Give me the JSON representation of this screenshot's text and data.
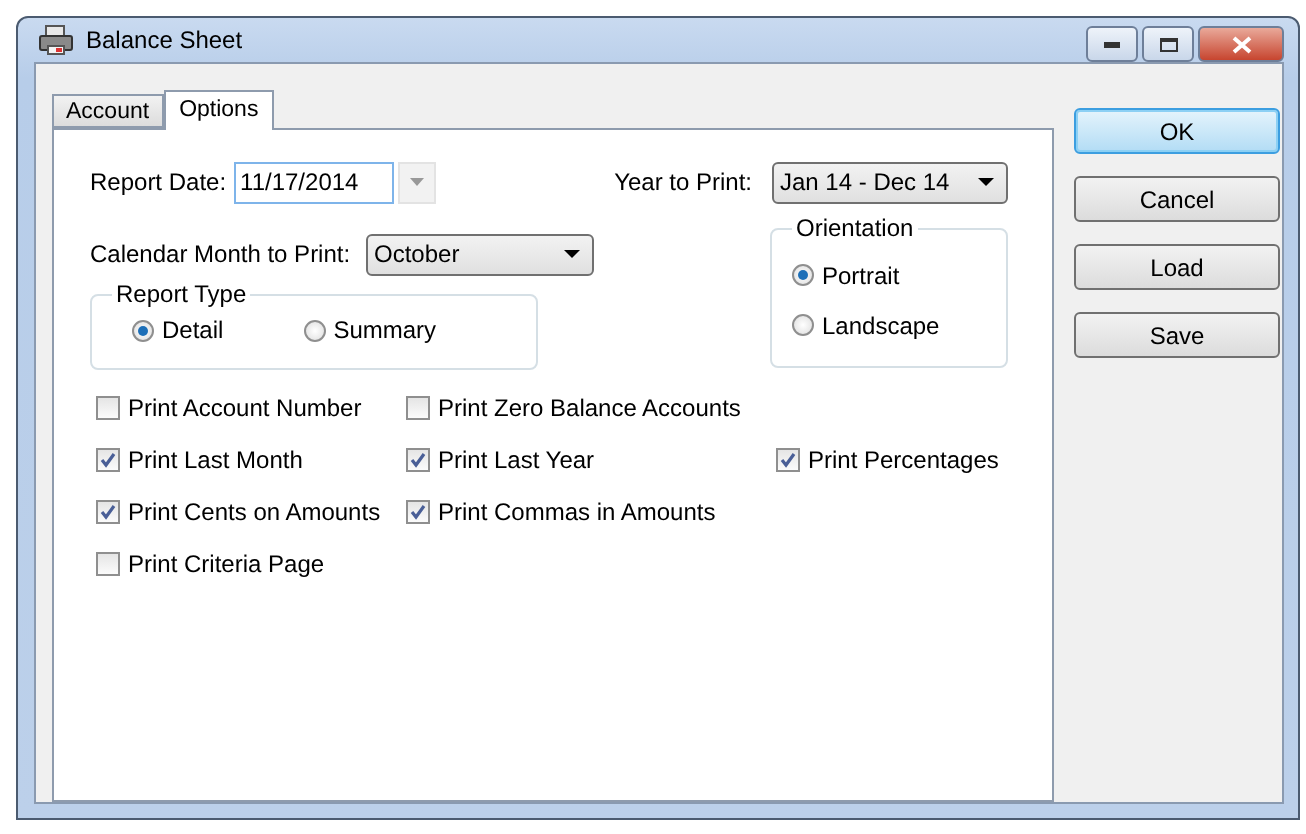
{
  "window": {
    "title": "Balance Sheet"
  },
  "tabs": [
    {
      "label": "Account",
      "selected": false
    },
    {
      "label": "Options",
      "selected": true
    }
  ],
  "report_date": {
    "label": "Report Date:",
    "value": "11/17/2014"
  },
  "year_to_print": {
    "label": "Year to Print:",
    "value": "Jan 14 - Dec 14"
  },
  "calendar_month": {
    "label": "Calendar Month to Print:",
    "value": "October"
  },
  "report_type": {
    "title": "Report Type",
    "options": [
      {
        "label": "Detail",
        "selected": true
      },
      {
        "label": "Summary",
        "selected": false
      }
    ]
  },
  "orientation": {
    "title": "Orientation",
    "options": [
      {
        "label": "Portrait",
        "selected": true
      },
      {
        "label": "Landscape",
        "selected": false
      }
    ]
  },
  "checkbox_rows": [
    [
      {
        "label": "Print Account Number",
        "checked": false
      },
      {
        "label": "Print Zero Balance Accounts",
        "checked": false
      }
    ],
    [
      {
        "label": "Print Last Month",
        "checked": true
      },
      {
        "label": "Print Last Year",
        "checked": true
      },
      {
        "label": "Print Percentages",
        "checked": true
      }
    ],
    [
      {
        "label": "Print Cents on Amounts",
        "checked": true
      },
      {
        "label": "Print Commas in Amounts",
        "checked": true
      }
    ],
    [
      {
        "label": "Print Criteria Page",
        "checked": false
      }
    ]
  ],
  "buttons": [
    {
      "label": "OK",
      "default": true
    },
    {
      "label": "Cancel",
      "default": false
    },
    {
      "label": "Load",
      "default": false
    },
    {
      "label": "Save",
      "default": false
    }
  ]
}
